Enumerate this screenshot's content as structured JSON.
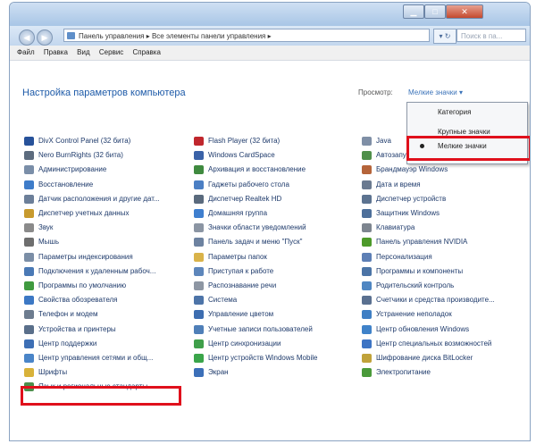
{
  "window": {
    "address": "Панель управления ▸ Все элементы панели управления ▸",
    "search_placeholder": "Поиск в па..."
  },
  "menu": [
    "Файл",
    "Правка",
    "Вид",
    "Сервис",
    "Справка"
  ],
  "heading": "Настройка параметров компьютера",
  "view_by": {
    "label": "Просмотр:",
    "value": "Мелкие значки ▾",
    "options": [
      "Категория",
      "Крупные значки",
      "Мелкие значки"
    ],
    "selected": "Мелкие значки"
  },
  "columns": [
    [
      {
        "label": "DivX Control Panel (32 бита)",
        "icon": "divx-icon",
        "color": "#27529a"
      },
      {
        "label": "Nero BurnRights (32 бита)",
        "icon": "nero-icon",
        "color": "#5c6b7e"
      },
      {
        "label": "Администрирование",
        "icon": "admin-tools-icon",
        "color": "#7a8ea8"
      },
      {
        "label": "Восстановление",
        "icon": "recovery-icon",
        "color": "#3e7cc9"
      },
      {
        "label": "Датчик расположения и другие дат...",
        "icon": "location-sensor-icon",
        "color": "#6c7f99"
      },
      {
        "label": "Диспетчер учетных данных",
        "icon": "credential-manager-icon",
        "color": "#c79a2e"
      },
      {
        "label": "Звук",
        "icon": "sound-icon",
        "color": "#8a8a8a"
      },
      {
        "label": "Мышь",
        "icon": "mouse-icon",
        "color": "#6e6e6e"
      },
      {
        "label": "Параметры индексирования",
        "icon": "indexing-icon",
        "color": "#7b8ea6"
      },
      {
        "label": "Подключения к удаленным рабоч...",
        "icon": "remote-desktop-icon",
        "color": "#4a79b5"
      },
      {
        "label": "Программы по умолчанию",
        "icon": "default-programs-icon",
        "color": "#3f9a3f"
      },
      {
        "label": "Свойства обозревателя",
        "icon": "internet-options-icon",
        "color": "#3c78c4"
      },
      {
        "label": "Телефон и модем",
        "icon": "phone-modem-icon",
        "color": "#6d7c8f"
      },
      {
        "label": "Устройства и принтеры",
        "icon": "devices-printers-icon",
        "color": "#5a6f8a"
      },
      {
        "label": "Центр поддержки",
        "icon": "action-center-icon",
        "color": "#3d6fb5"
      },
      {
        "label": "Центр управления сетями и общ...",
        "icon": "network-center-icon",
        "color": "#4a85c8"
      },
      {
        "label": "Шрифты",
        "icon": "fonts-icon",
        "color": "#d8b23a"
      },
      {
        "label": "Язык и региональные стандарты",
        "icon": "region-language-icon",
        "color": "#4c8f4c"
      }
    ],
    [
      {
        "label": "Flash Player (32 бита)",
        "icon": "flash-icon",
        "color": "#c0272d"
      },
      {
        "label": "Windows CardSpace",
        "icon": "cardspace-icon",
        "color": "#3a62a8"
      },
      {
        "label": "Архивация и восстановление",
        "icon": "backup-icon",
        "color": "#3f8a3f"
      },
      {
        "label": "Гаджеты рабочего стола",
        "icon": "gadgets-icon",
        "color": "#4b7fc4"
      },
      {
        "label": "Диспетчер Realtek HD",
        "icon": "realtek-icon",
        "color": "#5a6a7d"
      },
      {
        "label": "Домашняя группа",
        "icon": "homegroup-icon",
        "color": "#3f7fcf"
      },
      {
        "label": "Значки области уведомлений",
        "icon": "notification-icons-icon",
        "color": "#8b95a3"
      },
      {
        "label": "Панель задач и меню \"Пуск\"",
        "icon": "taskbar-icon",
        "color": "#6d82a0"
      },
      {
        "label": "Параметры папок",
        "icon": "folder-options-icon",
        "color": "#d9b34a"
      },
      {
        "label": "Приступая к работе",
        "icon": "getting-started-icon",
        "color": "#5d86bb"
      },
      {
        "label": "Распознавание речи",
        "icon": "speech-icon",
        "color": "#8d96a3"
      },
      {
        "label": "Система",
        "icon": "system-icon",
        "color": "#4d74a8"
      },
      {
        "label": "Управление цветом",
        "icon": "color-management-icon",
        "color": "#3d6db0"
      },
      {
        "label": "Учетные записи пользователей",
        "icon": "user-accounts-icon",
        "color": "#4f7fb8"
      },
      {
        "label": "Центр синхронизации",
        "icon": "sync-center-icon",
        "color": "#3f9f4a"
      },
      {
        "label": "Центр устройств Windows Mobile",
        "icon": "windows-mobile-icon",
        "color": "#3aa54a"
      },
      {
        "label": "Экран",
        "icon": "display-icon",
        "color": "#3c6fb8"
      }
    ],
    [
      {
        "label": "Java",
        "icon": "java-icon",
        "color": "#7f8fa6"
      },
      {
        "label": "Автозапуск",
        "icon": "autoplay-icon",
        "color": "#4f8f4a"
      },
      {
        "label": "Брандмауэр Windows",
        "icon": "firewall-icon",
        "color": "#b5643a"
      },
      {
        "label": "Дата и время",
        "icon": "date-time-icon",
        "color": "#6a7a90"
      },
      {
        "label": "Диспетчер устройств",
        "icon": "device-manager-icon",
        "color": "#5c7390"
      },
      {
        "label": "Защитник Windows",
        "icon": "defender-icon",
        "color": "#4d6f9a"
      },
      {
        "label": "Клавиатура",
        "icon": "keyboard-icon",
        "color": "#7d858f"
      },
      {
        "label": "Панель управления NVIDIA",
        "icon": "nvidia-icon",
        "color": "#4d9a2a"
      },
      {
        "label": "Персонализация",
        "icon": "personalization-icon",
        "color": "#5d7fb5"
      },
      {
        "label": "Программы и компоненты",
        "icon": "programs-features-icon",
        "color": "#4b74a6"
      },
      {
        "label": "Родительский контроль",
        "icon": "parental-controls-icon",
        "color": "#4f86c2"
      },
      {
        "label": "Счетчики и средства производите...",
        "icon": "performance-icon",
        "color": "#5a7090"
      },
      {
        "label": "Устранение неполадок",
        "icon": "troubleshooting-icon",
        "color": "#3f7fc4"
      },
      {
        "label": "Центр обновления Windows",
        "icon": "windows-update-icon",
        "color": "#3f82c9"
      },
      {
        "label": "Центр специальных возможностей",
        "icon": "ease-of-access-icon",
        "color": "#3d74c4"
      },
      {
        "label": "Шифрование диска BitLocker",
        "icon": "bitlocker-icon",
        "color": "#c0a23a"
      },
      {
        "label": "Электропитание",
        "icon": "power-options-icon",
        "color": "#4a9a3a"
      }
    ]
  ]
}
